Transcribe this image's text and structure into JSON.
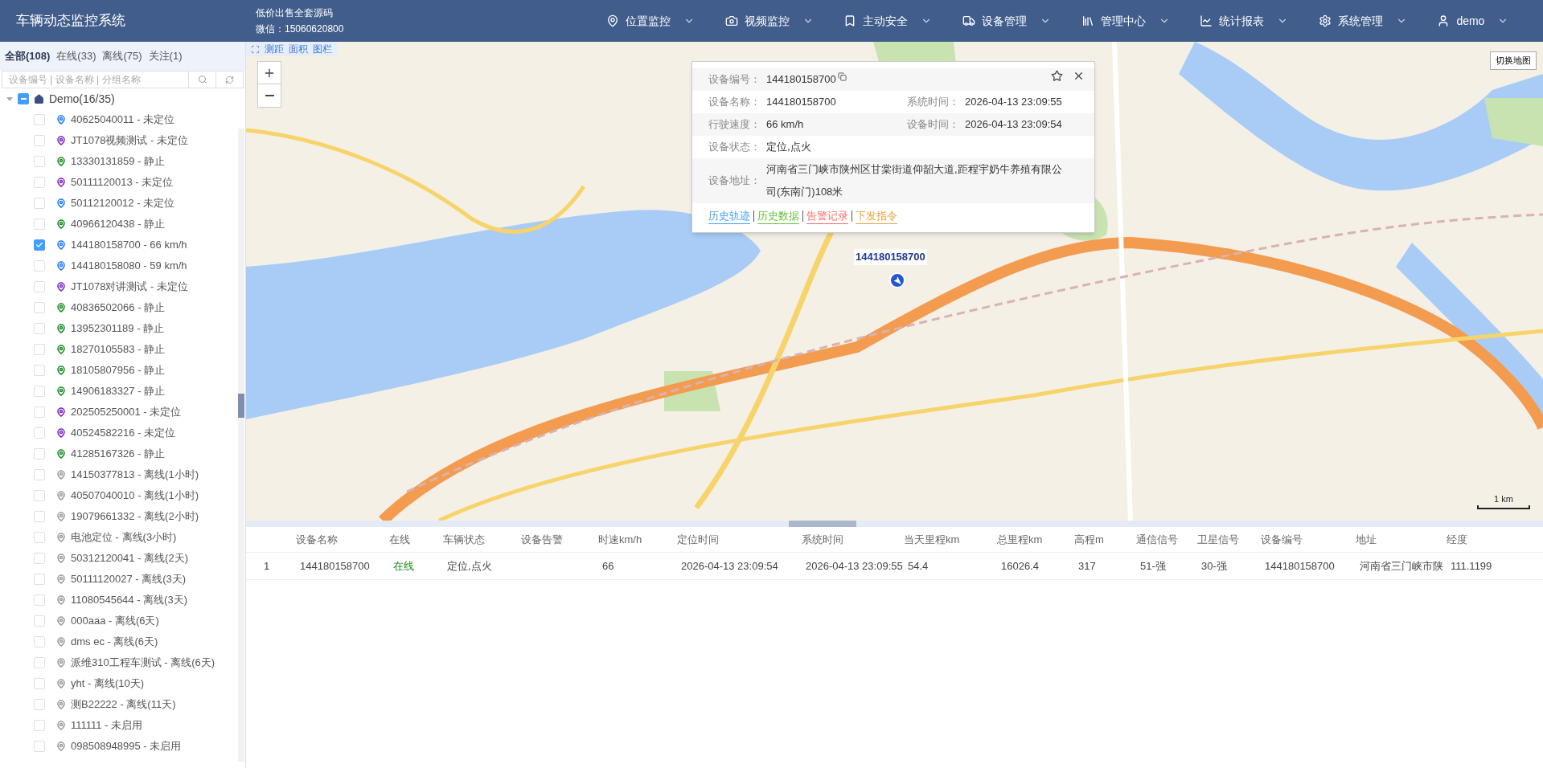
{
  "header": {
    "title": "车辆动态监控系统",
    "promo": [
      "低价出售全套源码",
      "微信：15060620800"
    ],
    "nav": [
      {
        "kind": "location",
        "label": "位置监控"
      },
      {
        "kind": "video",
        "label": "视频监控"
      },
      {
        "kind": "safety",
        "label": "主动安全"
      },
      {
        "kind": "device",
        "label": "设备管理"
      },
      {
        "kind": "manage",
        "label": "管理中心"
      },
      {
        "kind": "report",
        "label": "统计报表"
      },
      {
        "kind": "system",
        "label": "系统管理"
      },
      {
        "kind": "user",
        "label": "demo"
      }
    ]
  },
  "sidebar": {
    "tabs": [
      {
        "label": "全部(108)",
        "selected": true
      },
      {
        "label": "在线(33)",
        "selected": false
      },
      {
        "label": "离线(75)",
        "selected": false
      },
      {
        "label": "关注(1)",
        "selected": false
      }
    ],
    "search": {
      "placeholder": "设备编号 | 设备名称 | 分组名称"
    },
    "tree": {
      "label": "Demo(16/35)",
      "expanded": true,
      "indeterminate": true,
      "children": [
        {
          "label": "40625040011 - 未定位",
          "checked": false,
          "color": "#1677ff"
        },
        {
          "label": "JT1078视频测试 - 未定位",
          "checked": false,
          "color": "#7b1fc9"
        },
        {
          "label": "13330131859 - 静止",
          "checked": false,
          "color": "#138a1e"
        },
        {
          "label": "50111120013 - 未定位",
          "checked": false,
          "color": "#7b1fc9"
        },
        {
          "label": "50112120012 - 未定位",
          "checked": false,
          "color": "#1677ff"
        },
        {
          "label": "40966120438 - 静止",
          "checked": false,
          "color": "#138a1e"
        },
        {
          "label": "144180158700 - 66 km/h",
          "checked": true,
          "color": "#1677ff"
        },
        {
          "label": "144180158080 - 59 km/h",
          "checked": false,
          "color": "#1677ff"
        },
        {
          "label": "JT1078对讲测试 - 未定位",
          "checked": false,
          "color": "#7b1fc9"
        },
        {
          "label": "40836502066 - 静止",
          "checked": false,
          "color": "#138a1e"
        },
        {
          "label": "13952301189 - 静止",
          "checked": false,
          "color": "#138a1e"
        },
        {
          "label": "18270105583 - 静止",
          "checked": false,
          "color": "#138a1e"
        },
        {
          "label": "18105807956 - 静止",
          "checked": false,
          "color": "#138a1e"
        },
        {
          "label": "14906183327 - 静止",
          "checked": false,
          "color": "#138a1e"
        },
        {
          "label": "202505250001 - 未定位",
          "checked": false,
          "color": "#7b1fc9"
        },
        {
          "label": "40524582216 - 未定位",
          "checked": false,
          "color": "#7b1fc9"
        },
        {
          "label": "41285167326 - 静止",
          "checked": false,
          "color": "#138a1e"
        },
        {
          "label": "14150377813 - 离线(1小时)",
          "checked": false,
          "color": "#9a9a9a"
        },
        {
          "label": "40507040010 - 离线(1小时)",
          "checked": false,
          "color": "#9a9a9a"
        },
        {
          "label": "19079661332 - 离线(2小时)",
          "checked": false,
          "color": "#9a9a9a"
        },
        {
          "label": "电池定位 - 离线(3小时)",
          "checked": false,
          "color": "#9a9a9a"
        },
        {
          "label": "50312120041 - 离线(2天)",
          "checked": false,
          "color": "#9a9a9a"
        },
        {
          "label": "50111120027 - 离线(3天)",
          "checked": false,
          "color": "#9a9a9a"
        },
        {
          "label": "11080545644 - 离线(3天)",
          "checked": false,
          "color": "#9a9a9a"
        },
        {
          "label": "000aaa - 离线(6天)",
          "checked": false,
          "color": "#9a9a9a"
        },
        {
          "label": "dms ec - 离线(6天)",
          "checked": false,
          "color": "#9a9a9a"
        },
        {
          "label": "派维310工程车测试 - 离线(6天)",
          "checked": false,
          "color": "#9a9a9a"
        },
        {
          "label": "yht - 离线(10天)",
          "checked": false,
          "color": "#9a9a9a"
        },
        {
          "label": "测B22222 - 离线(11天)",
          "checked": false,
          "color": "#9a9a9a"
        },
        {
          "label": "111111 - 未启用",
          "checked": false,
          "color": "#9a9a9a"
        },
        {
          "label": "098508948995 - 未启用",
          "checked": false,
          "color": "#9a9a9a"
        }
      ]
    }
  },
  "map": {
    "tools": [
      "测距",
      "面积",
      "图栏"
    ],
    "switch_button": "切换地图",
    "scale": "1 km",
    "marker_label": "144180158700",
    "popup": {
      "rows": [
        {
          "label": "设备编号：",
          "value": "144180158700",
          "copyable": true
        },
        {
          "label": "设备名称：",
          "value": "144180158700",
          "label_2": "系统时间：",
          "value_2": "2026-04-13 23:09:55"
        },
        {
          "label": "行驶速度：",
          "value": "66 km/h",
          "label_2": "设备时间：",
          "value_2": "2026-04-13 23:09:54"
        },
        {
          "label": "设备状态：",
          "value": "定位,点火"
        },
        {
          "label": "设备地址：",
          "value": "河南省三门峡市陕州区甘棠街道仰韶大道,距程宇奶牛养殖有限公司(东南门)108米"
        }
      ],
      "links": [
        {
          "label": "历史轨迹",
          "color": "#409eff"
        },
        {
          "label": "历史数据",
          "color": "#67c23a"
        },
        {
          "label": "告警记录",
          "color": "#f56c6c"
        },
        {
          "label": "下发指令",
          "color": "#e6a23c"
        }
      ]
    }
  },
  "table": {
    "columns": [
      "设备名称",
      "在线",
      "车辆状态",
      "设备告警",
      "时速km/h",
      "定位时间",
      "系统时间",
      "当天里程km",
      "总里程km",
      "高程m",
      "通信信号",
      "卫星信号",
      "设备编号",
      "地址",
      "经度"
    ],
    "rows": [
      {
        "index": "1",
        "device_name": "144180158700",
        "online": "在线",
        "online_on": true,
        "vehicle_status": "定位,点火",
        "speed": "66",
        "fix_time": "2026-04-13 23:09:54",
        "system_time": "2026-04-13 23:09:55",
        "day_mileage": "54.4",
        "total_mileage": "16026.4",
        "elevation": "317",
        "comm_signal": "51-强",
        "sat_signal": "30-强",
        "device_no": "144180158700",
        "address": "河南省三门峡市陕",
        "longitude": "111.1199"
      }
    ]
  }
}
